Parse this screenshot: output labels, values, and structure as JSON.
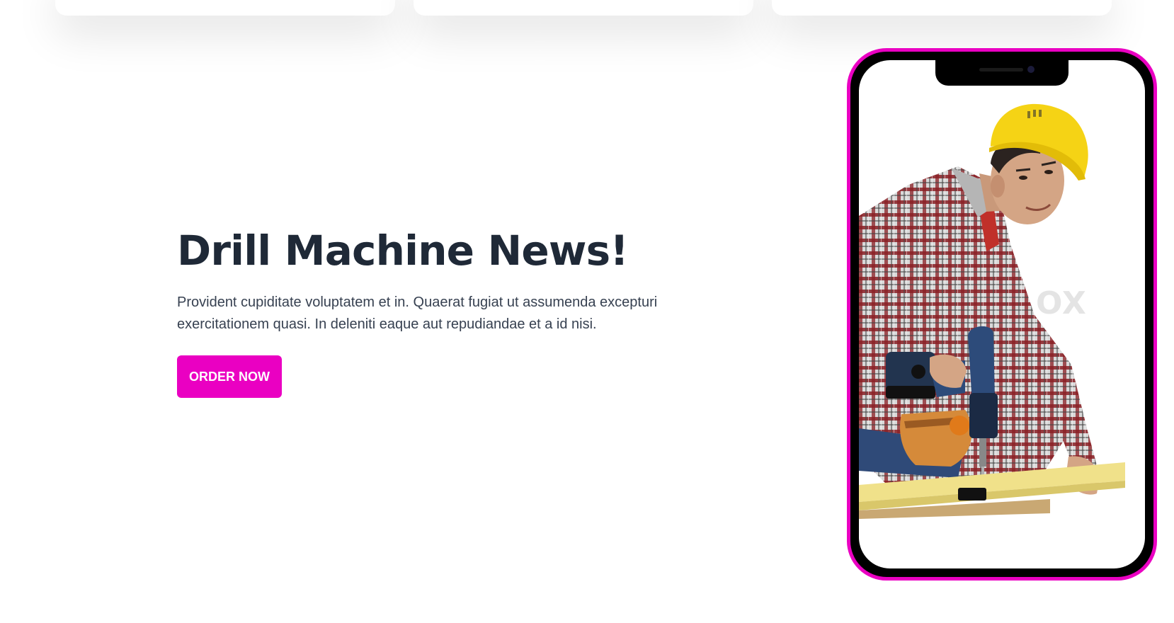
{
  "hero": {
    "title": "Drill Machine News!",
    "description": "Provident cupiditate voluptatem et in. Quaerat fugiat ut assumenda excepturi exercitationem quasi. In deleniti eaque aut repudiandae et a id nisi.",
    "button_label": "ORDER NOW"
  },
  "phone": {
    "image_alt": "Young worker in hard hat using a cordless drill on a wooden plank",
    "watermark": "OX"
  },
  "colors": {
    "accent": "#ea00c2",
    "heading": "#1f2937",
    "body_text": "#374151",
    "background": "#ffffff"
  }
}
